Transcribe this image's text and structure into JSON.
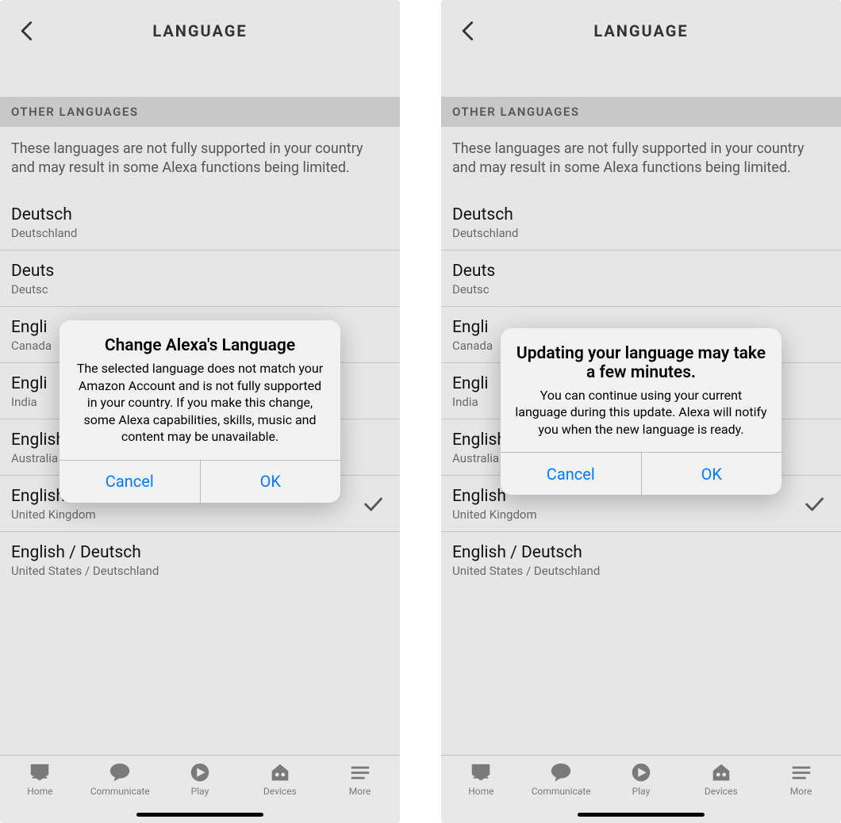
{
  "header": {
    "title": "LANGUAGE"
  },
  "section": {
    "header": "OTHER LANGUAGES",
    "description": "These languages are not fully supported in your country and may result in some Alexa functions being limited."
  },
  "languages": [
    {
      "name": "Deutsch",
      "sub": "Deutschland",
      "selected": false
    },
    {
      "name": "Deuts",
      "sub": "Deutsc",
      "selected": false
    },
    {
      "name": "Engli",
      "sub": "Canada",
      "selected": false
    },
    {
      "name": "Engli",
      "sub": "India",
      "selected": false
    },
    {
      "name": "English",
      "sub": "Australia",
      "selected": false
    },
    {
      "name": "English",
      "sub": "United Kingdom",
      "selected": true
    },
    {
      "name": "English / Deutsch",
      "sub": "United States / Deutschland",
      "selected": false
    }
  ],
  "tabs": [
    {
      "id": "home",
      "label": "Home"
    },
    {
      "id": "communicate",
      "label": "Communicate"
    },
    {
      "id": "play",
      "label": "Play"
    },
    {
      "id": "devices",
      "label": "Devices"
    },
    {
      "id": "more",
      "label": "More"
    }
  ],
  "dialogs": [
    {
      "title": "Change Alexa's Language",
      "message": "The selected language does not match your Amazon Account and is not fully supported in your country. If you make this change, some Alexa capabilities, skills, music and content may be unavailable.",
      "cancel": "Cancel",
      "ok": "OK"
    },
    {
      "title": "Updating your language may take a few minutes.",
      "message": "You can continue using your current language during this update. Alexa will notify you when the new language is ready.",
      "cancel": "Cancel",
      "ok": "OK"
    }
  ]
}
